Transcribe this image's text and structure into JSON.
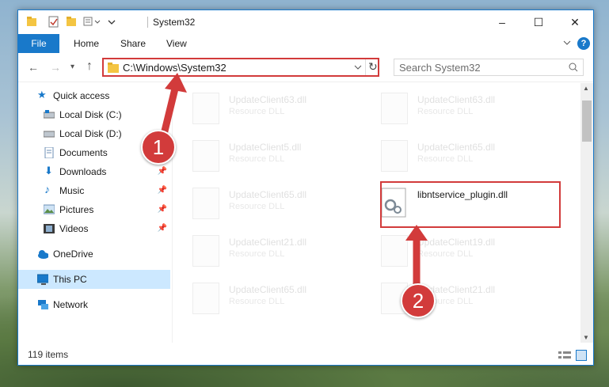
{
  "window": {
    "title": "System32",
    "controls": [
      "–",
      "☐",
      "✕"
    ]
  },
  "ribbon": {
    "file": "File",
    "tabs": [
      "Home",
      "Share",
      "View"
    ]
  },
  "nav": {
    "address": "C:\\Windows\\System32",
    "search_placeholder": "Search System32"
  },
  "sidebar": {
    "items": [
      {
        "label": "Quick access"
      },
      {
        "label": "Local Disk (C:)"
      },
      {
        "label": "Local Disk (D:)"
      },
      {
        "label": "Documents"
      },
      {
        "label": "Downloads"
      },
      {
        "label": "Music"
      },
      {
        "label": "Pictures"
      },
      {
        "label": "Videos"
      },
      {
        "label": "OneDrive"
      },
      {
        "label": "This PC"
      },
      {
        "label": "Network"
      }
    ]
  },
  "files": {
    "left": [
      {
        "name": "UpdateClient63.dll",
        "type": "Resource DLL"
      },
      {
        "name": "UpdateClient5.dll",
        "type": "Resource DLL"
      },
      {
        "name": "UpdateClient65.dll",
        "type": "Resource DLL"
      },
      {
        "name": "UpdateClient21.dll",
        "type": "Resource DLL"
      },
      {
        "name": "UpdateClient65.dll",
        "type": "Resource DLL"
      }
    ],
    "right": [
      {
        "name": "UpdateClient63.dll",
        "type": "Resource DLL"
      },
      {
        "name": "UpdateClient65.dll",
        "type": "Resource DLL"
      },
      {
        "name": "libntservice_plugin.dll",
        "type": ""
      },
      {
        "name": "UpdateClient19.dll",
        "type": "Resource DLL"
      },
      {
        "name": "UpdateClient21.dll",
        "type": "Resource DLL"
      }
    ]
  },
  "status": {
    "count": "119 items"
  },
  "callouts": [
    "1",
    "2"
  ],
  "colors": {
    "accent": "#1979ca",
    "callout": "#d23b3b"
  }
}
